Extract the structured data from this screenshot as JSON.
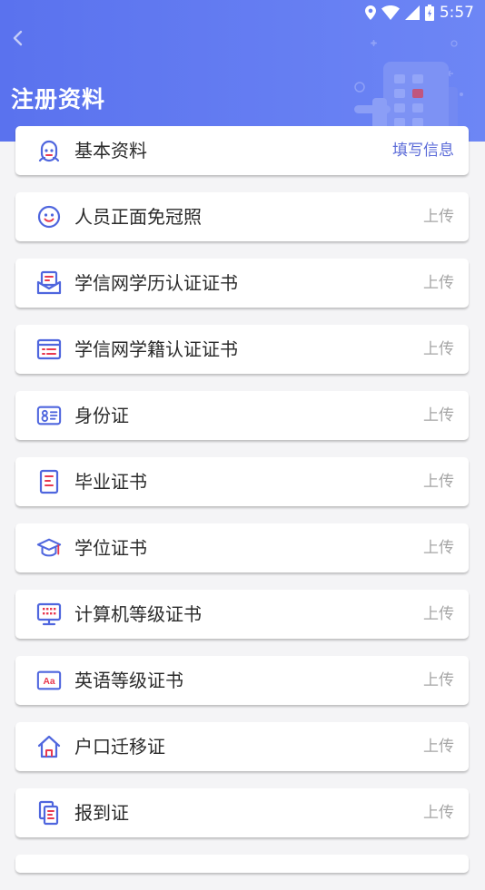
{
  "status_bar": {
    "time": "5:57"
  },
  "header": {
    "title": "注册资料"
  },
  "colors": {
    "header_start": "#5a72ee",
    "header_end": "#6d86f5",
    "accent": "#5b6bd8",
    "icon_red": "#e8384f"
  },
  "items": [
    {
      "label": "基本资料",
      "action": "填写信息",
      "icon": "robot-face-icon"
    },
    {
      "label": "人员正面免冠照",
      "action": "上传",
      "icon": "smiley-face-icon"
    },
    {
      "label": "学信网学历认证证书",
      "action": "上传",
      "icon": "envelope-certificate-icon"
    },
    {
      "label": "学信网学籍认证证书",
      "action": "上传",
      "icon": "document-list-icon"
    },
    {
      "label": "身份证",
      "action": "上传",
      "icon": "id-card-icon"
    },
    {
      "label": "毕业证书",
      "action": "上传",
      "icon": "certificate-icon"
    },
    {
      "label": "学位证书",
      "action": "上传",
      "icon": "graduation-cap-icon"
    },
    {
      "label": "计算机等级证书",
      "action": "上传",
      "icon": "computer-monitor-icon"
    },
    {
      "label": "英语等级证书",
      "action": "上传",
      "icon": "aa-text-icon"
    },
    {
      "label": "户口迁移证",
      "action": "上传",
      "icon": "house-icon"
    },
    {
      "label": "报到证",
      "action": "上传",
      "icon": "copy-document-icon"
    }
  ]
}
